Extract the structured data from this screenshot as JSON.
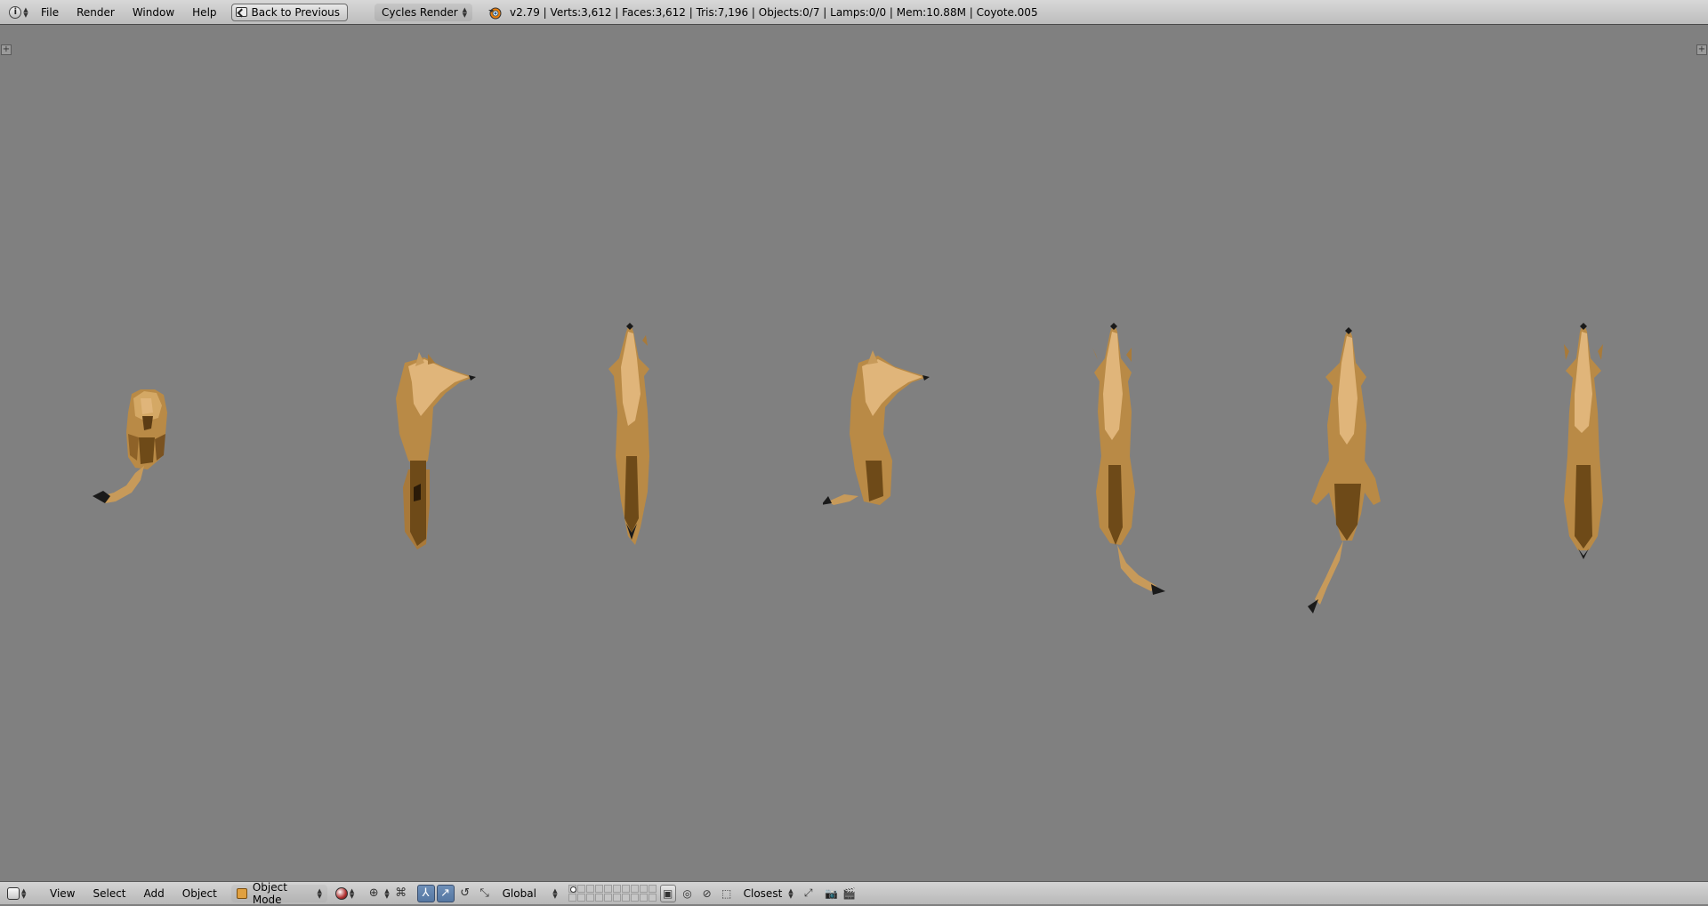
{
  "top_header": {
    "menus": [
      "File",
      "Render",
      "Window",
      "Help"
    ],
    "back_button": "Back to Previous",
    "render_engine": "Cycles Render",
    "stats": "v2.79 | Verts:3,612 | Faces:3,612 | Tris:7,196 | Objects:0/7 | Lamps:0/0 | Mem:10.88M | Coyote.005",
    "editor_type_icon": "info-icon"
  },
  "viewport": {
    "background_color": "#808080",
    "coyote_models": [
      "coyote-curled",
      "coyote-side-left",
      "coyote-top-sitting",
      "coyote-side-right",
      "coyote-top-tail-right",
      "coyote-top-tail-down",
      "coyote-top-front"
    ],
    "fur_colors": {
      "light": "#e0b57a",
      "mid": "#b98a46",
      "dark": "#6e4a18",
      "shadow": "#4a3010",
      "tip": "#1a1a1a"
    }
  },
  "bottom_header": {
    "editor_type_icon": "3d-view-icon",
    "menus": [
      "View",
      "Select",
      "Add",
      "Object"
    ],
    "mode": "Object Mode",
    "viewport_shading_icon": "solid-shading-icon",
    "pivot_icon": "pivot-icon",
    "manipulator_icons": [
      "translate-icon",
      "rotate-icon",
      "scale-icon"
    ],
    "orientation": "Global",
    "snap_target": "Closest",
    "render_icons": [
      "render-still-icon",
      "render-animation-icon"
    ]
  }
}
